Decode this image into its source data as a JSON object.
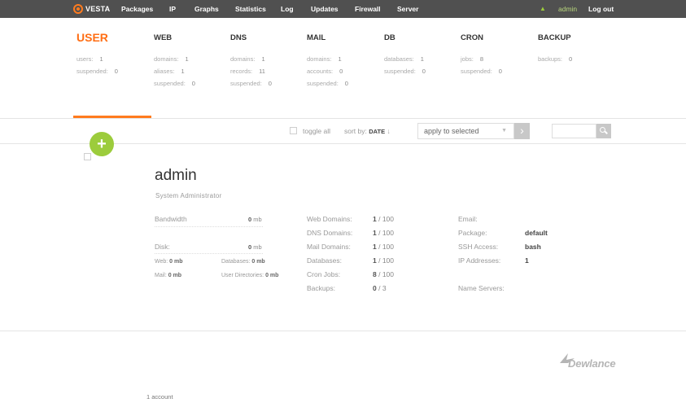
{
  "nav": {
    "logo": "VESTA",
    "items": [
      "Packages",
      "IP",
      "Graphs",
      "Statistics",
      "Log",
      "Updates",
      "Firewall",
      "Server"
    ],
    "user": "admin",
    "logout": "Log out"
  },
  "stats": [
    {
      "title": "USER",
      "lines": [
        {
          "label": "users:",
          "value": "1"
        },
        {
          "label": "suspended:",
          "value": "0"
        }
      ]
    },
    {
      "title": "WEB",
      "lines": [
        {
          "label": "domains:",
          "value": "1"
        },
        {
          "label": "aliases:",
          "value": "1"
        },
        {
          "label": "suspended:",
          "value": "0"
        }
      ]
    },
    {
      "title": "DNS",
      "lines": [
        {
          "label": "domains:",
          "value": "1"
        },
        {
          "label": "records:",
          "value": "11"
        },
        {
          "label": "suspended:",
          "value": "0"
        }
      ]
    },
    {
      "title": "MAIL",
      "lines": [
        {
          "label": "domains:",
          "value": "1"
        },
        {
          "label": "accounts:",
          "value": "0"
        },
        {
          "label": "suspended:",
          "value": "0"
        }
      ]
    },
    {
      "title": "DB",
      "lines": [
        {
          "label": "databases:",
          "value": "1"
        },
        {
          "label": "suspended:",
          "value": "0"
        }
      ]
    },
    {
      "title": "CRON",
      "lines": [
        {
          "label": "jobs:",
          "value": "8"
        },
        {
          "label": "suspended:",
          "value": "0"
        }
      ]
    },
    {
      "title": "BACKUP",
      "lines": [
        {
          "label": "backups:",
          "value": "0"
        }
      ]
    }
  ],
  "toolbar": {
    "toggle_all": "toggle all",
    "sort_by": "sort by:",
    "sort_value": "DATE",
    "sort_arrow": "↓",
    "apply_selected": "apply to selected",
    "go": "›"
  },
  "user": {
    "name": "admin",
    "role": "System Administrator",
    "bandwidth_label": "Bandwidth",
    "bandwidth_value": "0",
    "disk_label": "Disk:",
    "disk_value": "0",
    "unit": "mb",
    "web_label": "Web:",
    "web_value": "0 mb",
    "databases_label": "Databases:",
    "databases_value": "0 mb",
    "mail_label": "Mail:",
    "mail_value": "0 mb",
    "userdirs_label": "User Directories:",
    "userdirs_value": "0 mb",
    "counters": [
      {
        "label": "Web Domains:",
        "used": "1",
        "limit": "/ 100"
      },
      {
        "label": "DNS Domains:",
        "used": "1",
        "limit": "/ 100"
      },
      {
        "label": "Mail Domains:",
        "used": "1",
        "limit": "/ 100"
      },
      {
        "label": "Databases:",
        "used": "1",
        "limit": "/ 100"
      },
      {
        "label": "Cron Jobs:",
        "used": "8",
        "limit": "/ 100"
      },
      {
        "label": "Backups:",
        "used": "0",
        "limit": "/ 3"
      }
    ],
    "email_label": "Email:",
    "package_label": "Package:",
    "package_value": "default",
    "ssh_label": "SSH Access:",
    "ssh_value": "bash",
    "ip_label": "IP Addresses:",
    "ip_value": "1",
    "ns_label": "Name Servers:"
  },
  "footer": {
    "count": "1 account",
    "brand": "Dewlance"
  },
  "icons": {
    "add": "plus-icon",
    "search": "search-icon",
    "notify": "bell-icon"
  },
  "colors": {
    "accent": "#ff7b1e",
    "green": "#9ccc3c",
    "nav_bg": "#505050"
  }
}
